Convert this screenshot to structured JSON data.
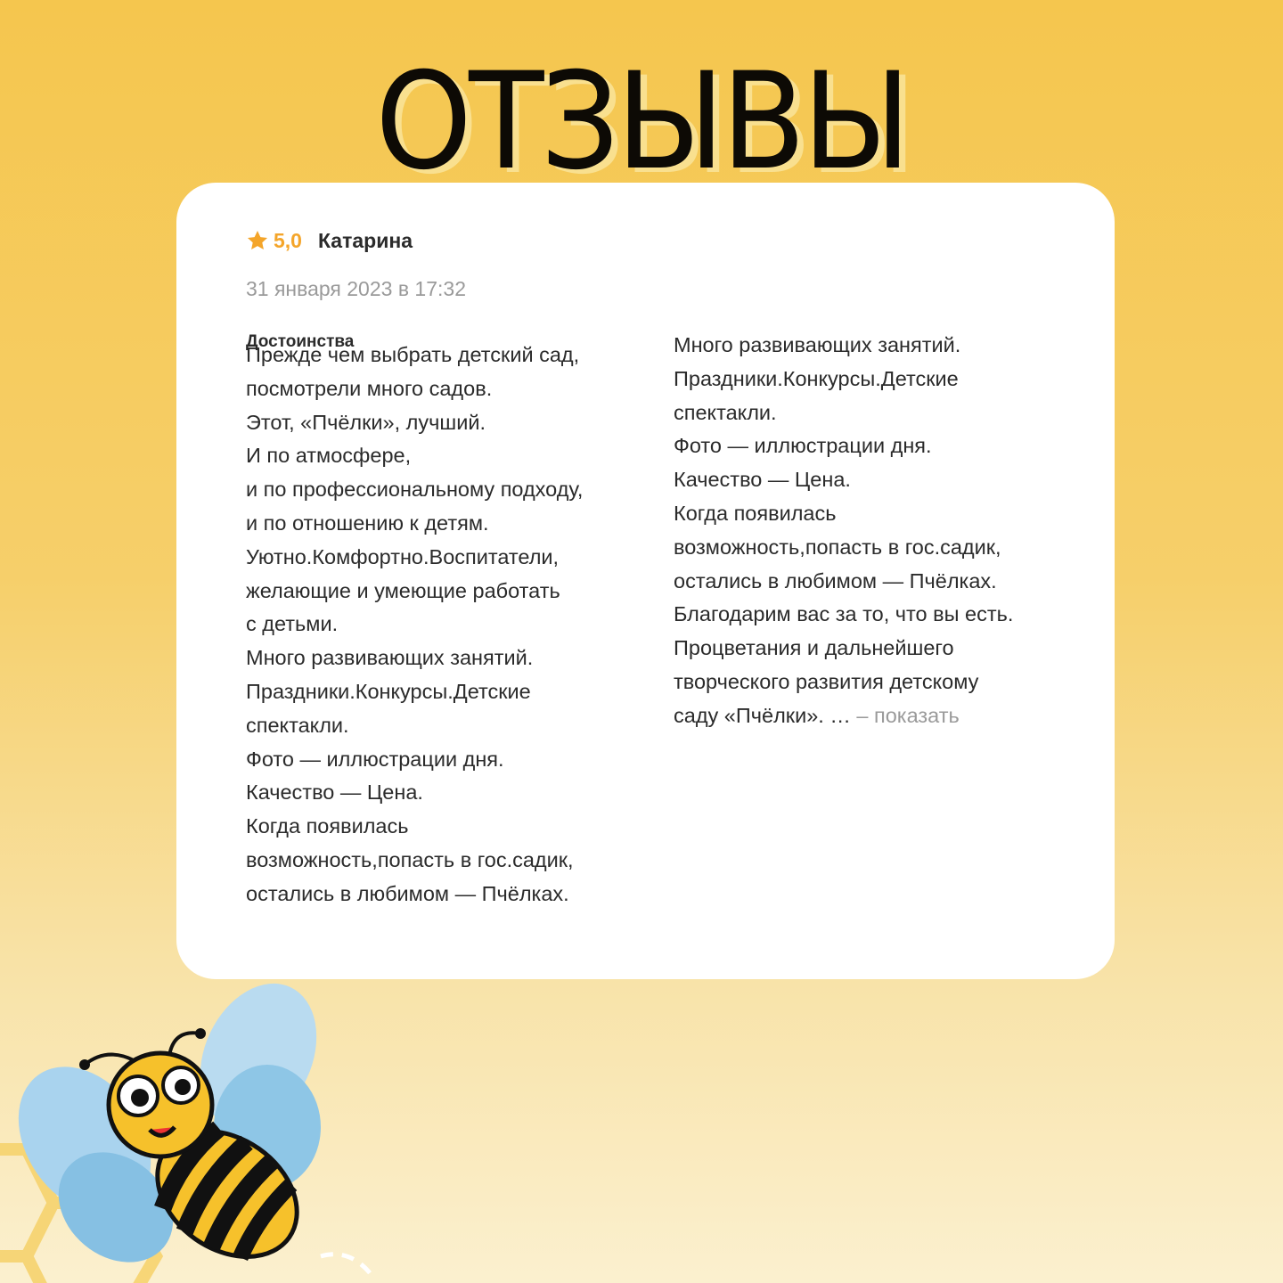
{
  "header": {
    "title": "ОТЗЫВЫ"
  },
  "review": {
    "rating": "5,0",
    "author": "Катарина",
    "date": "31 января 2023 в 17:32",
    "section_title": "Достоинства",
    "left_lines": [
      "Прежде чем выбрать детский сад,",
      "посмотрели много садов.",
      "Этот, «Пчёлки», лучший.",
      "И по атмосфере,",
      "и по профессиональному подходу,",
      "и по отношению к детям.",
      "Уютно.Комфортно.Воспитатели,",
      "желающие и умеющие работать",
      "с детьми.",
      "Много развивающих занятий.",
      "Праздники.Конкурсы.Детские",
      "спектакли.",
      "Фото — иллюстрации дня.",
      "Качество — Цена.",
      "Когда появилась",
      "возможность,попасть в гос.садик,",
      "остались в любимом — Пчёлках."
    ],
    "right_lines": [
      "Много развивающих занятий.",
      "Праздники.Конкурсы.Детские",
      "спектакли.",
      "Фото — иллюстрации дня.",
      "Качество — Цена.",
      "Когда появилась",
      "возможность,попасть в гос.садик,",
      "остались в любимом — Пчёлках.",
      "Благодарим вас за то, что вы есть.",
      "Процветания и дальнейшего",
      "творческого развития детскому"
    ],
    "last_line": "саду «Пчёлки».  …",
    "show_more": " – показать"
  },
  "colors": {
    "accent": "#f4a52a",
    "background": "#f5c64e",
    "card": "#ffffff"
  }
}
